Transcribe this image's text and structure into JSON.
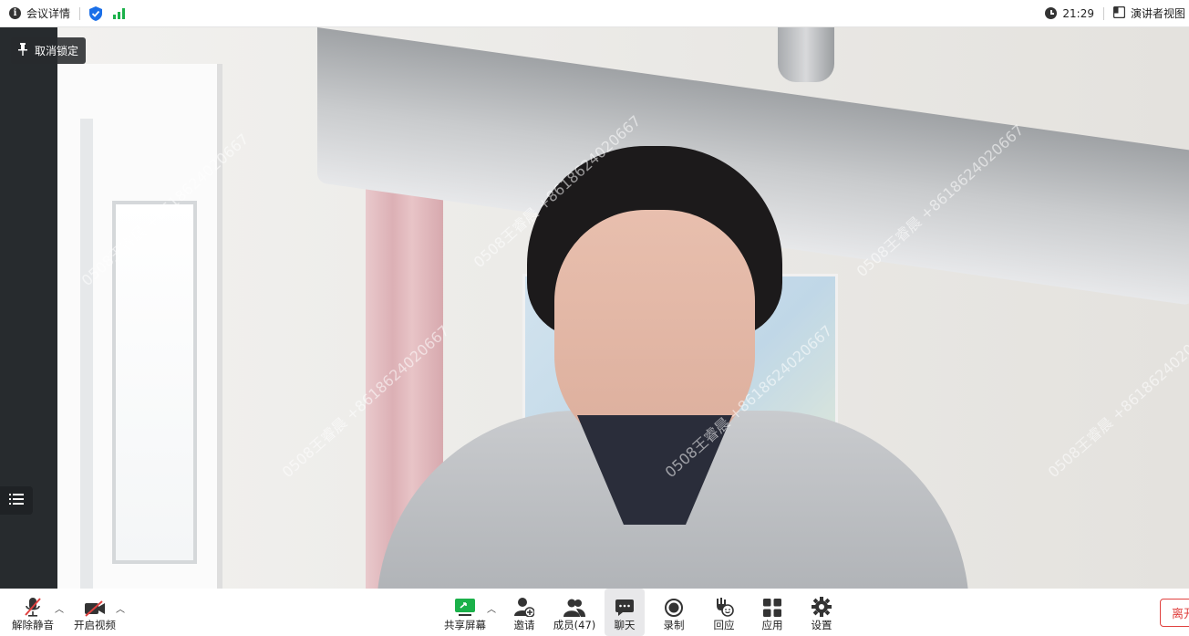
{
  "topbar": {
    "meeting_info_label": "会议详情",
    "time": "21:29",
    "view_label": "演讲者视图",
    "icons": [
      "info-icon",
      "shield-check-icon",
      "signal-icon",
      "clock-icon",
      "view-layout-icon"
    ],
    "accent_color": "#1a6fe8",
    "signal_color": "#1bb14a"
  },
  "video": {
    "unpin_label": "取消锁定",
    "watermark_text": "0508王睿晨 +8618624020667"
  },
  "toolbar": {
    "unmute_label": "解除静音",
    "start_video_label": "开启视频",
    "share_screen_label": "共享屏幕",
    "invite_label": "邀请",
    "members_label": "成员(47)",
    "chat_label": "聊天",
    "record_label": "录制",
    "react_label": "回应",
    "apps_label": "应用",
    "settings_label": "设置",
    "leave_label": "离开",
    "share_color": "#1bb14a",
    "leave_color": "#e0413f",
    "muted_color": "#e0413f"
  }
}
